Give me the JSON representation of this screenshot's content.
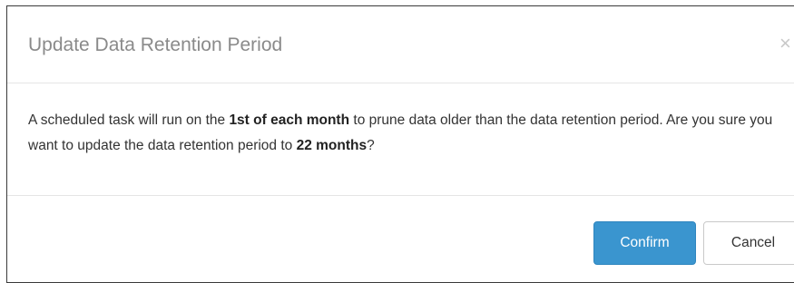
{
  "dialog": {
    "title": "Update Data Retention Period",
    "close_glyph": "×",
    "close_icon": "close-icon",
    "message": {
      "part1": "A scheduled task will run on the ",
      "bold1": "1st of each month",
      "part2": " to prune data older than the data retention period. Are you sure you want to update the data retention period to ",
      "bold2": "22 months",
      "part3": "?"
    },
    "confirm_label": "Confirm",
    "cancel_label": "Cancel"
  },
  "colors": {
    "primary": "#3a95cf",
    "title": "#8a8a8a",
    "text": "#333333",
    "divider": "#e5e5e5"
  }
}
